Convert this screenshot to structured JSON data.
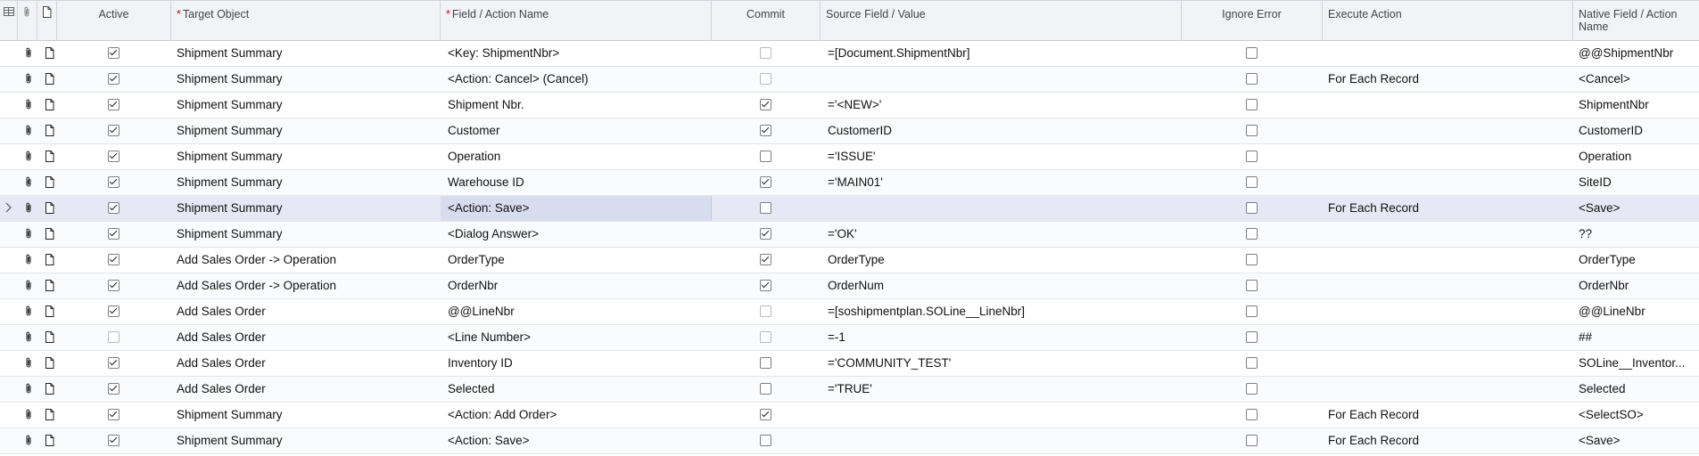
{
  "columns": {
    "active": "Active",
    "target_object": "Target Object",
    "field_action_name": "Field / Action Name",
    "commit": "Commit",
    "source_field_value": "Source Field / Value",
    "ignore_error": "Ignore Error",
    "execute_action": "Execute Action",
    "native_field_action_name": "Native Field / Action Name",
    "required_marker": "*"
  },
  "icons": {
    "header_grid": "grid-settings-icon",
    "header_attachment": "paperclip-icon",
    "header_note": "document-icon",
    "row_attachment": "paperclip-icon",
    "row_note": "document-icon",
    "row_indicator": "chevron-right-icon"
  },
  "rows": [
    {
      "active": true,
      "target_object": "Shipment Summary",
      "field": "<Key: ShipmentNbr>",
      "commit": false,
      "commit_dim": true,
      "source": "=[Document.ShipmentNbr]",
      "ignore_error": false,
      "execute_action": "",
      "native": "@@ShipmentNbr"
    },
    {
      "active": true,
      "target_object": "Shipment Summary",
      "field": "<Action: Cancel> (Cancel)",
      "commit": false,
      "commit_dim": true,
      "source": "",
      "ignore_error": false,
      "execute_action": "For Each Record",
      "native": "<Cancel>"
    },
    {
      "active": true,
      "target_object": "Shipment Summary",
      "field": "Shipment Nbr.",
      "commit": true,
      "commit_dim": false,
      "source": "='<NEW>'",
      "ignore_error": false,
      "execute_action": "",
      "native": "ShipmentNbr"
    },
    {
      "active": true,
      "target_object": "Shipment Summary",
      "field": "Customer",
      "commit": true,
      "commit_dim": false,
      "source": "CustomerID",
      "ignore_error": false,
      "execute_action": "",
      "native": "CustomerID"
    },
    {
      "active": true,
      "target_object": "Shipment Summary",
      "field": "Operation",
      "commit": false,
      "commit_dim": false,
      "source": "='ISSUE'",
      "ignore_error": false,
      "execute_action": "",
      "native": "Operation"
    },
    {
      "active": true,
      "target_object": "Shipment Summary",
      "field": "Warehouse ID",
      "commit": true,
      "commit_dim": false,
      "source": "='MAIN01'",
      "ignore_error": false,
      "execute_action": "",
      "native": "SiteID"
    },
    {
      "active": true,
      "target_object": "Shipment Summary",
      "field": "<Action: Save>",
      "commit": false,
      "commit_dim": false,
      "source": "",
      "ignore_error": false,
      "execute_action": "For Each Record",
      "native": "<Save>",
      "selected": true
    },
    {
      "active": true,
      "target_object": "Shipment Summary",
      "field": "<Dialog Answer>",
      "commit": true,
      "commit_dim": false,
      "source": "='OK'",
      "ignore_error": false,
      "execute_action": "",
      "native": "??"
    },
    {
      "active": true,
      "target_object": "Add Sales Order -> Operation",
      "field": "OrderType",
      "commit": true,
      "commit_dim": false,
      "source": "OrderType",
      "ignore_error": false,
      "execute_action": "",
      "native": "OrderType"
    },
    {
      "active": true,
      "target_object": "Add Sales Order -> Operation",
      "field": "OrderNbr",
      "commit": true,
      "commit_dim": false,
      "source": "OrderNum",
      "ignore_error": false,
      "execute_action": "",
      "native": "OrderNbr"
    },
    {
      "active": true,
      "target_object": "Add Sales Order",
      "field": "@@LineNbr",
      "commit": false,
      "commit_dim": true,
      "source": "=[soshipmentplan.SOLine__LineNbr]",
      "ignore_error": false,
      "execute_action": "",
      "native": "@@LineNbr"
    },
    {
      "active": false,
      "target_object": "Add Sales Order",
      "field": "<Line Number>",
      "commit": false,
      "commit_dim": true,
      "source": "=-1",
      "ignore_error": false,
      "execute_action": "",
      "native": "##"
    },
    {
      "active": true,
      "target_object": "Add Sales Order",
      "field": "Inventory ID",
      "commit": false,
      "commit_dim": false,
      "source": "='COMMUNITY_TEST'",
      "ignore_error": false,
      "execute_action": "",
      "native": "SOLine__Inventor..."
    },
    {
      "active": true,
      "target_object": "Add Sales Order",
      "field": "Selected",
      "commit": false,
      "commit_dim": false,
      "source": "='TRUE'",
      "ignore_error": false,
      "execute_action": "",
      "native": "Selected"
    },
    {
      "active": true,
      "target_object": "Shipment Summary",
      "field": "<Action: Add Order>",
      "commit": true,
      "commit_dim": false,
      "source": "",
      "ignore_error": false,
      "execute_action": "For Each Record",
      "native": "<SelectSO>"
    },
    {
      "active": true,
      "target_object": "Shipment Summary",
      "field": "<Action: Save>",
      "commit": false,
      "commit_dim": false,
      "source": "",
      "ignore_error": false,
      "execute_action": "For Each Record",
      "native": "<Save>"
    }
  ]
}
